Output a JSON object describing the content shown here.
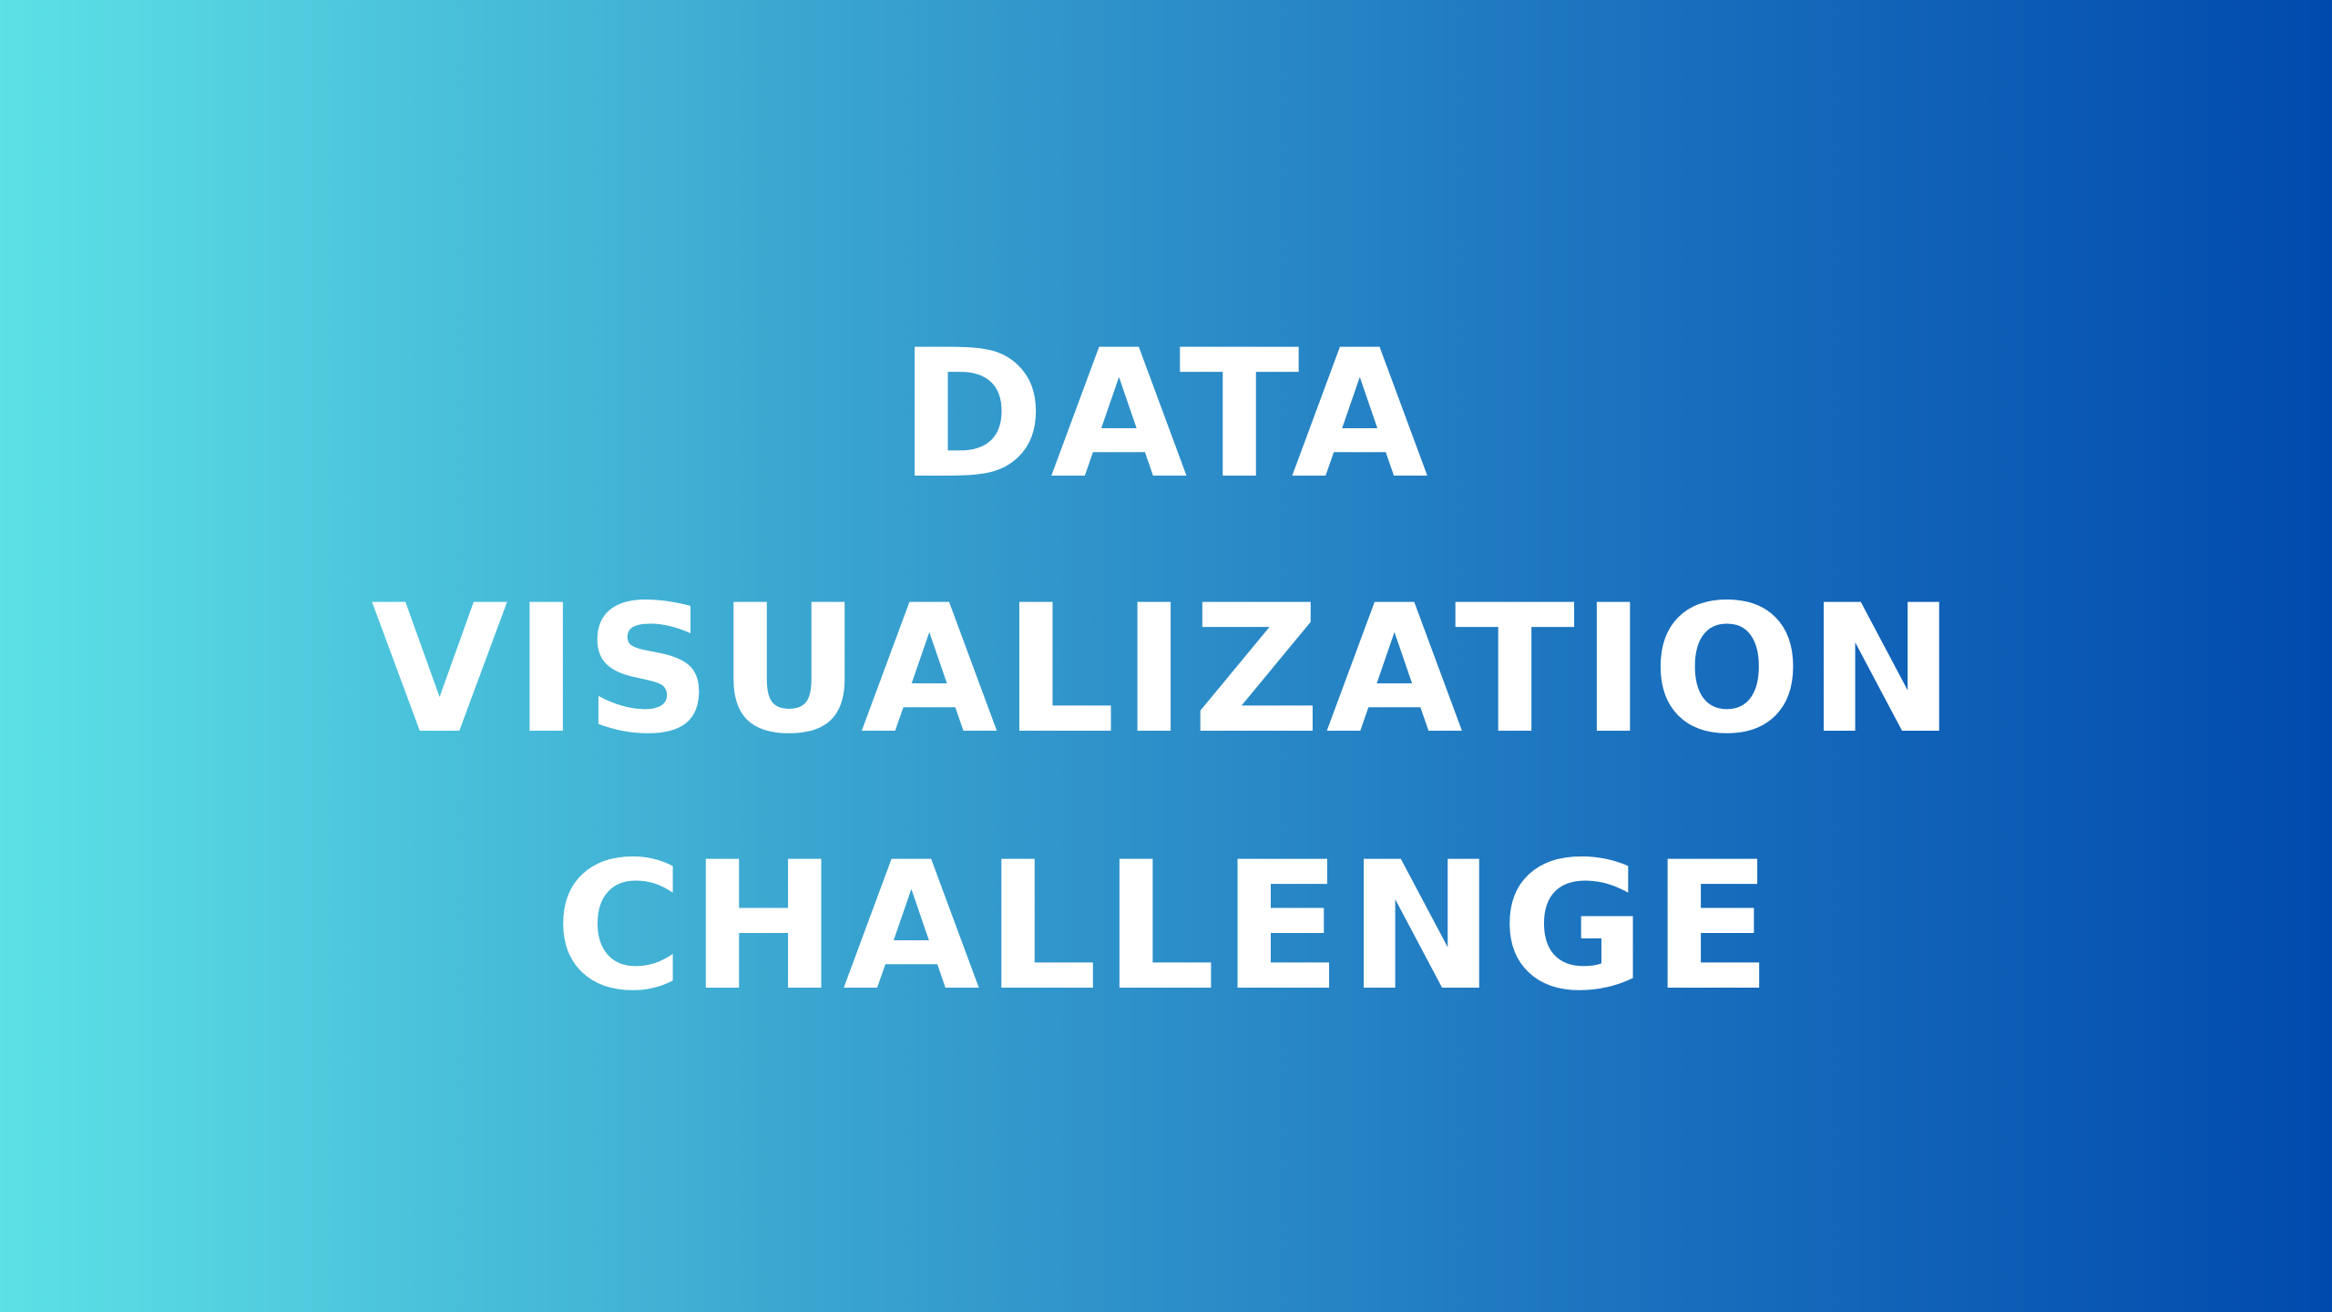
{
  "banner": {
    "background_colors": [
      "#5ce1e6",
      "#004aad"
    ],
    "text_color": "#ffffff",
    "lines": [
      "DATA",
      "VISUALIZATION",
      "CHALLENGE"
    ]
  }
}
